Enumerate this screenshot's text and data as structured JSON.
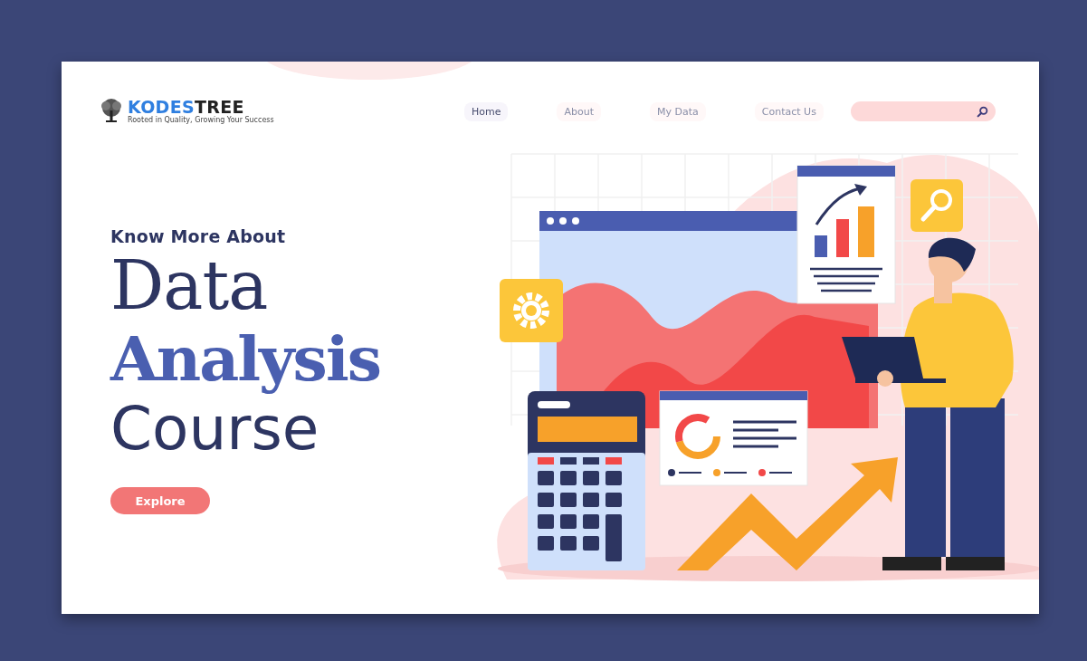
{
  "logo": {
    "name_primary": "KODES",
    "name_secondary": "TREE",
    "tagline": "Rooted in Quality, Growing Your Success"
  },
  "nav": [
    {
      "label": "Home",
      "selected": true
    },
    {
      "label": "About",
      "selected": false
    },
    {
      "label": "My Data",
      "selected": false
    },
    {
      "label": "Contact Us",
      "selected": false
    }
  ],
  "hero": {
    "kicker": "Know More About",
    "title_line_1": "Data",
    "title_line_2": "Analysis",
    "title_line_3": "Course",
    "button": "Explore"
  }
}
